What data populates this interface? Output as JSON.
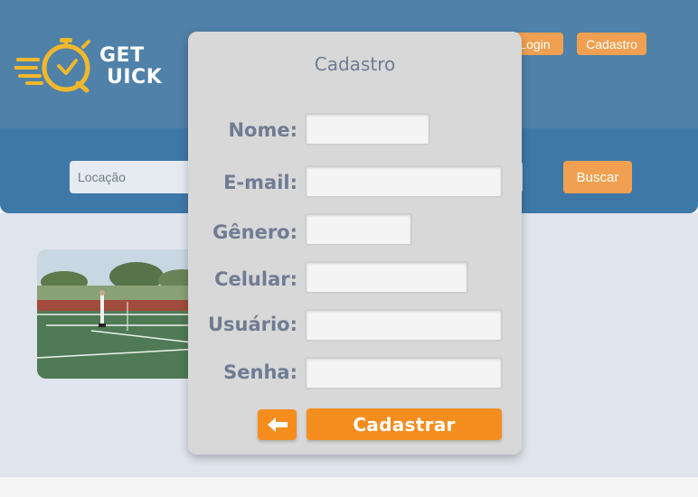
{
  "header": {
    "logo_line1": "GET",
    "logo_line2": "UICK",
    "login_label": "Login",
    "cadastro_label": "Cadastro"
  },
  "search": {
    "location_placeholder": "Locação",
    "buscar_label": "Buscar"
  },
  "modal": {
    "title": "Cadastro",
    "fields": [
      {
        "label": "Nome:",
        "value": ""
      },
      {
        "label": "E-mail:",
        "value": ""
      },
      {
        "label": "Gênero:",
        "value": ""
      },
      {
        "label": "Celular:",
        "value": ""
      },
      {
        "label": "Usuário:",
        "value": ""
      },
      {
        "label": "Senha:",
        "value": ""
      }
    ],
    "back_icon": "arrow-left-icon",
    "submit_label": "Cadastrar"
  },
  "colors": {
    "header_blue": "#5081a8",
    "search_band_blue": "#3e78a8",
    "accent_orange": "#f58d1e",
    "header_button_orange": "#f0a050",
    "modal_bg": "#d8d8d8",
    "label_gray_blue": "#6f7c93",
    "logo_yellow": "#f2b82b"
  }
}
